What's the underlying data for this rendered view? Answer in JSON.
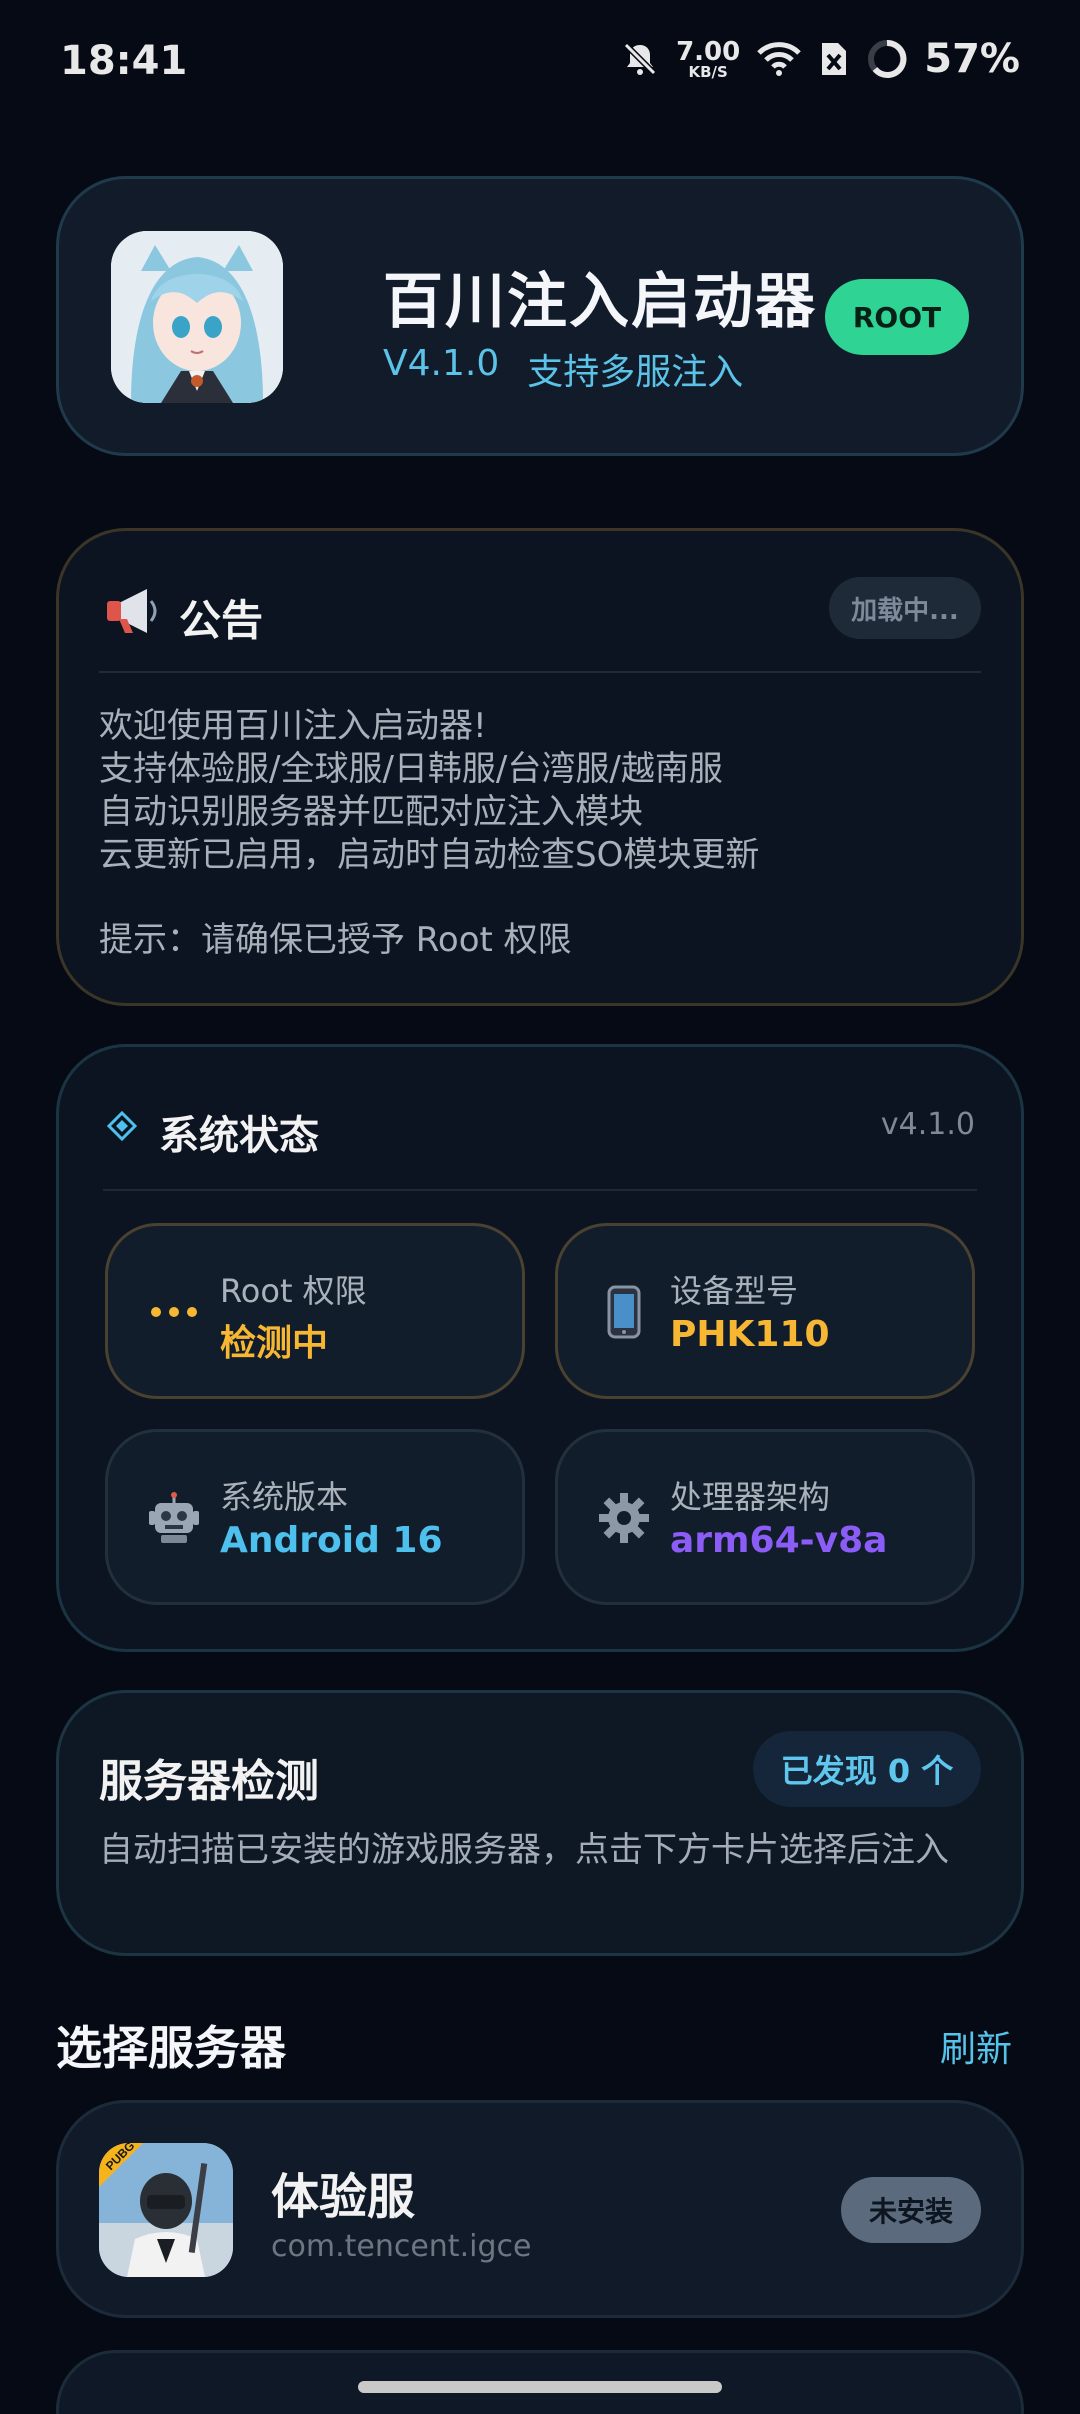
{
  "status_bar": {
    "time": "18:41",
    "net_speed_value": "7.00",
    "net_speed_unit": "KB/S",
    "battery_percent": "57%"
  },
  "app": {
    "title": "百川注入启动器",
    "version": "V4.1.0",
    "tagline": "支持多服注入",
    "root_badge": "ROOT"
  },
  "notice": {
    "title": "公告",
    "loading_label": "加载中...",
    "lines": [
      "欢迎使用百川注入启动器!",
      "支持体验服/全球服/日韩服/台湾服/越南服",
      "自动识别服务器并匹配对应注入模块",
      "云更新已启用，启动时自动检查SO模块更新"
    ],
    "tip": "提示：请确保已授予 Root 权限"
  },
  "system_status": {
    "title": "系统状态",
    "version": "v4.1.0",
    "tiles": [
      {
        "label": "Root 权限",
        "value": "检测中",
        "icon": "ellipsis-icon",
        "color": "#f7b733"
      },
      {
        "label": "设备型号",
        "value": "PHK110",
        "icon": "phone-icon",
        "color": "#f7b733"
      },
      {
        "label": "系统版本",
        "value": "Android 16",
        "icon": "robot-icon",
        "color": "#4ec0ee"
      },
      {
        "label": "处理器架构",
        "value": "arm64-v8a",
        "icon": "gear-icon",
        "color": "#8b5cf6"
      }
    ]
  },
  "server_detect": {
    "title": "服务器检测",
    "found_label": "已发现 0 个",
    "description": "自动扫描已安装的游戏服务器，点击下方卡片选择后注入"
  },
  "server_list": {
    "title": "选择服务器",
    "refresh_label": "刷新",
    "items": [
      {
        "name": "体验服",
        "package": "com.tencent.igce",
        "status": "未安装",
        "icon": "pubg-game-icon"
      }
    ]
  }
}
